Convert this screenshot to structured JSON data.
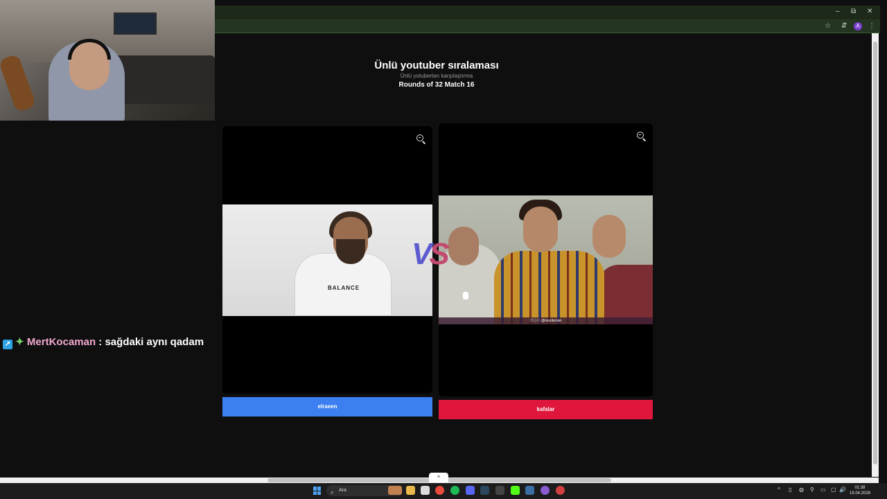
{
  "browser": {
    "window_controls": {
      "minimize": "–",
      "restore": "⧉",
      "close": "✕"
    },
    "toolbar_icons": {
      "bookmark": "☆",
      "reader": "⇵",
      "profile_initial": "A",
      "menu": "⋮"
    }
  },
  "chat": {
    "badge_icon": "arrow-badge-icon",
    "badge_glyph": "↗",
    "sparkle_glyph": "✦",
    "username": "MertKocaman",
    "separator": " : ",
    "message": "sağdaki aynı qadam"
  },
  "page": {
    "title": "Ünlü youtuber sıralaması",
    "subtitle": "Ünlü yotuberları karşılaştırma",
    "round": "Rounds of 32 Match 16"
  },
  "match": {
    "vs_text": {
      "v": "V",
      "s": "S"
    },
    "left": {
      "name": "elraeen",
      "shirt_text": "BALANCE",
      "button_color": "#3b7ff0"
    },
    "right": {
      "name": "kafalar",
      "watermark": "ⓕⓘⓣ @muzikonair",
      "button_color": "#e0163d"
    }
  },
  "taskbar": {
    "search_placeholder": "Ara",
    "search_glyph": "⌕",
    "expand_glyph": "^",
    "time": "01:38",
    "date": "15.04.2026",
    "tray_glyphs": [
      "^",
      "▯",
      "◍",
      "⚲",
      "▭",
      "▢",
      "🔊"
    ]
  },
  "colors": {
    "accent_blue": "#3b7ff0",
    "accent_red": "#e0163d",
    "vs_blue": "#5c5bcf",
    "vs_pink": "#c2496f"
  }
}
